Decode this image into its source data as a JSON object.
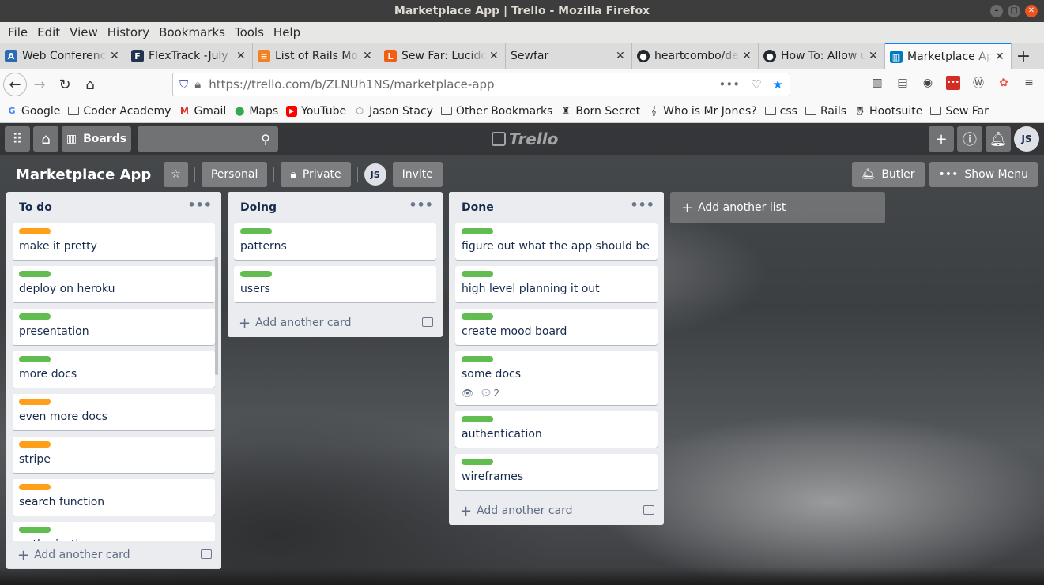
{
  "window": {
    "title": "Marketplace App | Trello - Mozilla Firefox"
  },
  "menu": [
    "File",
    "Edit",
    "View",
    "History",
    "Bookmarks",
    "Tools",
    "Help"
  ],
  "tabs": [
    {
      "label": "Web Conference",
      "icon": "canvas-icon",
      "color": "#2a6bb3"
    },
    {
      "label": "FlexTrack -July",
      "icon": "flextrack-icon",
      "color": "#22344f"
    },
    {
      "label": "List of Rails Mo",
      "icon": "stackoverflow-icon",
      "color": "#f48024"
    },
    {
      "label": "Sew Far: Lucidc",
      "icon": "lucid-icon",
      "color": "#f25f14"
    },
    {
      "label": "Sewfar",
      "icon": "",
      "color": ""
    },
    {
      "label": "heartcombo/de",
      "icon": "github-icon",
      "color": "#24292e"
    },
    {
      "label": "How To: Allow u",
      "icon": "github-icon",
      "color": "#24292e"
    },
    {
      "label": "Marketplace Ap",
      "icon": "trello-icon",
      "color": "#0079bf"
    }
  ],
  "url": "https://trello.com/b/ZLNUh1NS/marketplace-app",
  "bookmarks": [
    {
      "label": "Google",
      "type": "google"
    },
    {
      "label": "Coder Academy",
      "type": "folder"
    },
    {
      "label": "Gmail",
      "type": "gmail"
    },
    {
      "label": "Maps",
      "type": "maps"
    },
    {
      "label": "YouTube",
      "type": "youtube"
    },
    {
      "label": "Jason Stacy",
      "type": "site"
    },
    {
      "label": "Other Bookmarks",
      "type": "folder"
    },
    {
      "label": "Born Secret",
      "type": "site"
    },
    {
      "label": "Who is Mr Jones?",
      "type": "site"
    },
    {
      "label": "css",
      "type": "folder"
    },
    {
      "label": "Rails",
      "type": "folder"
    },
    {
      "label": "Hootsuite",
      "type": "site"
    },
    {
      "label": "Sew Far",
      "type": "folder"
    }
  ],
  "header": {
    "boards_label": "Boards",
    "logo": "Trello",
    "avatar": "JS"
  },
  "board": {
    "title": "Marketplace App",
    "visibility_team": "Personal",
    "visibility": "Private",
    "member_avatar": "JS",
    "invite": "Invite",
    "butler": "Butler",
    "show_menu": "Show Menu"
  },
  "lists": [
    {
      "name": "To do",
      "add_card": "Add another card",
      "cards": [
        {
          "title": "make it pretty",
          "label": "#ff9f1a"
        },
        {
          "title": "deploy on heroku",
          "label": "#61bd4f"
        },
        {
          "title": "presentation",
          "label": "#61bd4f"
        },
        {
          "title": "more docs",
          "label": "#61bd4f"
        },
        {
          "title": "even more docs",
          "label": "#ff9f1a"
        },
        {
          "title": "stripe",
          "label": "#ff9f1a"
        },
        {
          "title": "search function",
          "label": "#ff9f1a"
        },
        {
          "title": "authorisation",
          "label": "#61bd4f"
        }
      ]
    },
    {
      "name": "Doing",
      "add_card": "Add another card",
      "cards": [
        {
          "title": "patterns",
          "label": "#61bd4f"
        },
        {
          "title": "users",
          "label": "#61bd4f"
        }
      ]
    },
    {
      "name": "Done",
      "add_card": "Add another card",
      "cards": [
        {
          "title": "figure out what the app should be",
          "label": "#61bd4f"
        },
        {
          "title": "high level planning it out",
          "label": "#61bd4f"
        },
        {
          "title": "create mood board",
          "label": "#61bd4f"
        },
        {
          "title": "some docs",
          "label": "#61bd4f",
          "comments": "2"
        },
        {
          "title": "authentication",
          "label": "#61bd4f"
        },
        {
          "title": "wireframes",
          "label": "#61bd4f"
        }
      ]
    }
  ],
  "add_list": "Add another list"
}
